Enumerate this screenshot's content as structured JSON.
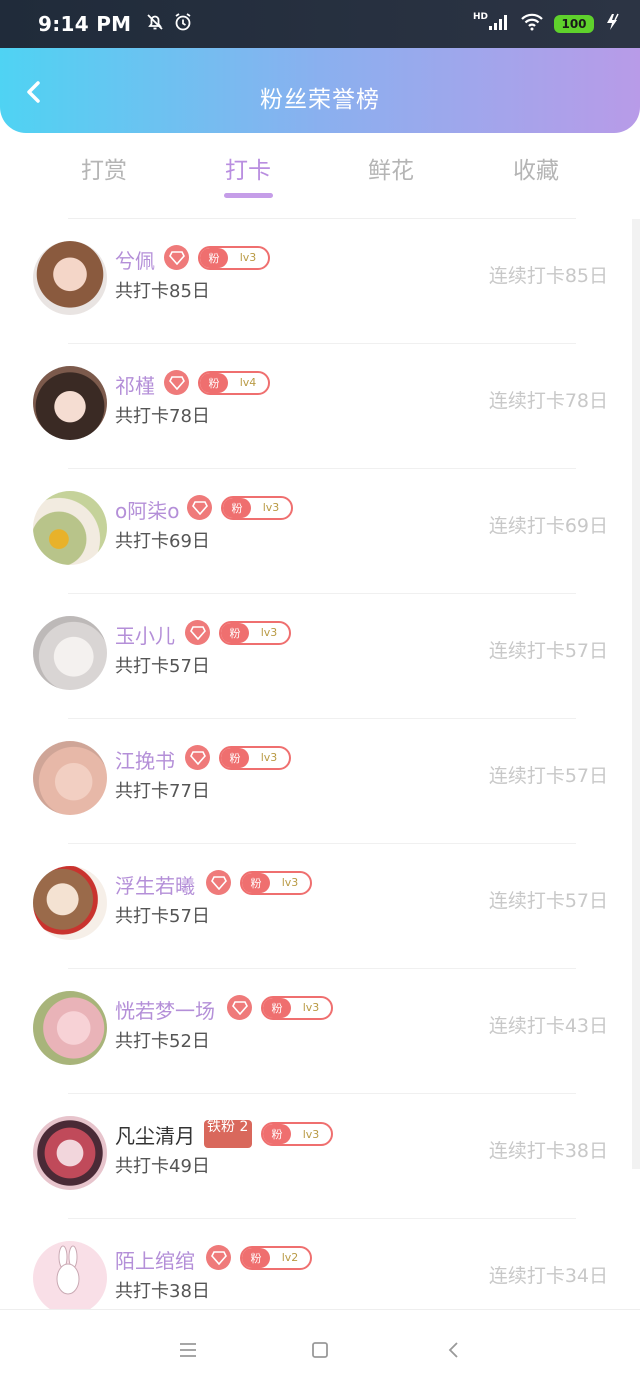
{
  "status_bar": {
    "time": "9:14 PM",
    "battery": "100",
    "network": "HD"
  },
  "header": {
    "title": "粉丝荣誉榜"
  },
  "tabs": [
    {
      "label": "打赏"
    },
    {
      "label": "打卡"
    },
    {
      "label": "鲜花"
    },
    {
      "label": "收藏"
    }
  ],
  "active_tab": "打卡",
  "colors": {
    "accent": "#b98ee0",
    "badge": "#ef6f6f",
    "header_start": "#4fd3f3",
    "header_end": "#b89be8"
  },
  "fans": [
    {
      "name": "兮佩",
      "total": "共打卡85日",
      "streak": "连续打卡85日",
      "fan_label": "粉",
      "level": "lv3"
    },
    {
      "name": "祁槿",
      "total": "共打卡78日",
      "streak": "连续打卡78日",
      "fan_label": "粉",
      "level": "lv4"
    },
    {
      "name": "o阿柒o",
      "total": "共打卡69日",
      "streak": "连续打卡69日",
      "fan_label": "粉",
      "level": "lv3"
    },
    {
      "name": "玉小儿",
      "total": "共打卡57日",
      "streak": "连续打卡57日",
      "fan_label": "粉",
      "level": "lv3"
    },
    {
      "name": "江挽书",
      "total": "共打卡77日",
      "streak": "连续打卡57日",
      "fan_label": "粉",
      "level": "lv3"
    },
    {
      "name": "浮生若曦",
      "total": "共打卡57日",
      "streak": "连续打卡57日",
      "fan_label": "粉",
      "level": "lv3"
    },
    {
      "name": "恍若梦一场",
      "total": "共打卡52日",
      "streak": "连续打卡43日",
      "fan_label": "粉",
      "level": "lv3"
    },
    {
      "name": "凡尘清月",
      "total": "共打卡49日",
      "streak": "连续打卡38日",
      "fan_label": "粉",
      "level": "lv3",
      "title_badge": "铁粉 2"
    },
    {
      "name": "陌上绾绾",
      "total": "共打卡38日",
      "streak": "连续打卡34日",
      "fan_label": "粉",
      "level": "lv2"
    }
  ]
}
